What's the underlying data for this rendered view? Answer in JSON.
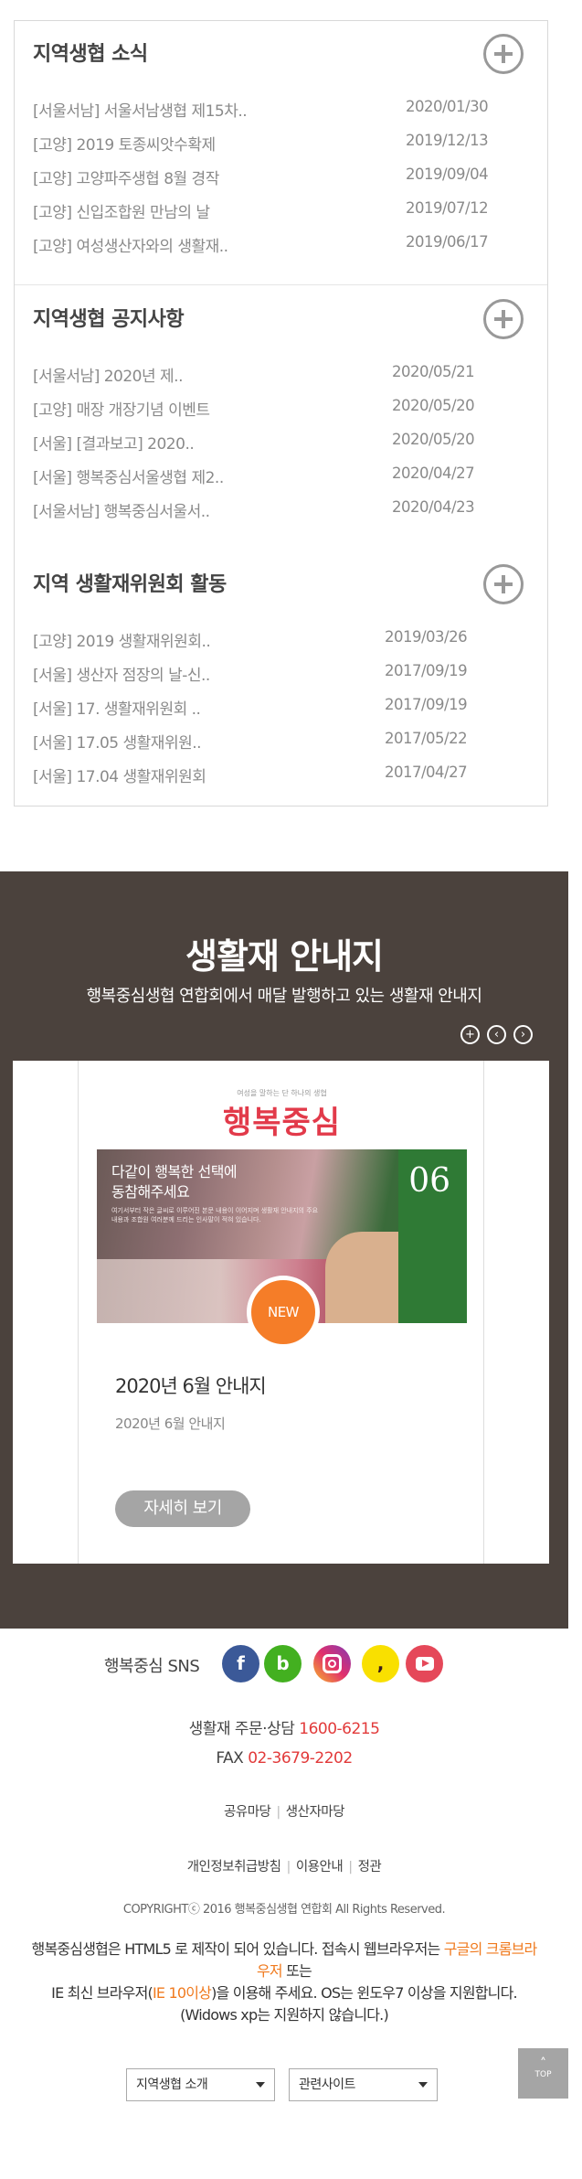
{
  "sections": [
    {
      "title": "지역생협 소식",
      "items": [
        {
          "title": "[서울서남] 서울서남생협 제15차..",
          "date": "2020/01/30"
        },
        {
          "title": "[고양] 2019 토종씨앗수확제",
          "date": "2019/12/13"
        },
        {
          "title": "[고양] 고양파주생협 8월 경작",
          "date": "2019/09/04"
        },
        {
          "title": "[고양] 신입조합원 만남의 날",
          "date": "2019/07/12"
        },
        {
          "title": "[고양] 여성생산자와의 생활재..",
          "date": "2019/06/17"
        }
      ]
    },
    {
      "title": "지역생협 공지사항",
      "items": [
        {
          "title": "[서울서남] 2020년 제..",
          "date": "2020/05/21"
        },
        {
          "title": "[고양] 매장 개장기념 이벤트",
          "date": "2020/05/20"
        },
        {
          "title": "[서울] [결과보고] 2020..",
          "date": "2020/05/20"
        },
        {
          "title": "[서울] 행복중심서울생협 제2..",
          "date": "2020/04/27"
        },
        {
          "title": "[서울서남] 행복중심서울서..",
          "date": "2020/04/23"
        }
      ]
    },
    {
      "title": "지역 생활재위원회 활동",
      "items": [
        {
          "title": "[고양] 2019 생활재위원회..",
          "date": "2019/03/26"
        },
        {
          "title": "[서울] 생산자 점장의 날-신..",
          "date": "2017/09/19"
        },
        {
          "title": "[서울] 17. 생활재위원회 ..",
          "date": "2017/09/19"
        },
        {
          "title": "[서울] 17.05 생활재위원..",
          "date": "2017/05/22"
        },
        {
          "title": "[서울] 17.04 생활재위원회",
          "date": "2017/04/27"
        }
      ]
    }
  ],
  "guide": {
    "title": "생활재 안내지",
    "subtitle": "행복중심생협 연합회에서 매달 발행하고 있는 생활재 안내지",
    "magazine": {
      "small_text": "여성을 말하는 단 하나의 생협",
      "brand": "행복중심",
      "headline_1": "다같이 행복한 선택에",
      "headline_2": "동참해주세요",
      "body_text": "여기서부터 작은 글씨로 이루어진 본문 내용이 이어지며 생활재 안내지의 주요 내용과 조합원 여러분께 드리는 인사말이 적혀 있습니다.",
      "issue": "06",
      "badge": "NEW"
    },
    "card_title": "2020년 6월 안내지",
    "card_sub": "2020년 6월 안내지",
    "more_label": "자세히 보기"
  },
  "footer": {
    "sns_label": "행복중심 SNS",
    "sns_icons": [
      "facebook-icon",
      "band-icon",
      "instagram-icon",
      "kakaostory-icon",
      "youtube-icon"
    ],
    "sns_glyphs": {
      "facebook": "f",
      "band": "b",
      "kakao": ","
    },
    "order_label": "생활재 주문·상담",
    "order_phone": "1600-6215",
    "fax_label": "FAX",
    "fax_number": "02-3679-2202",
    "links_1": [
      "공유마당",
      "생산자마당"
    ],
    "links_2": [
      "개인정보취급방침",
      "이용안내",
      "정관"
    ],
    "copyright": "COPYRIGHTⓒ 2016 행복중심생협 연합회 All Rights Reserved.",
    "notice_a": "행복중심생협은 HTML5 로 제작이 되어 있습니다. 접속시 웹브라우저는 ",
    "notice_b": "구글의 크롬브라우저",
    "notice_c": " 또는",
    "notice_d": "IE 최신 브라우저(",
    "notice_e": "IE 10이상",
    "notice_f": ")을 이용해 주세요. OS는 윈도우7 이상을 지원합니다.(Widows xp는 지원하지 않습니다.)",
    "top_label": "TOP",
    "select_1": "지역생협 소개",
    "select_2": "관련사이트"
  },
  "colors": {
    "accent_red": "#e23a3a",
    "accent_orange": "#f07a1e",
    "dark_bg": "#4b423d",
    "button_gray": "#a5a5a5"
  }
}
